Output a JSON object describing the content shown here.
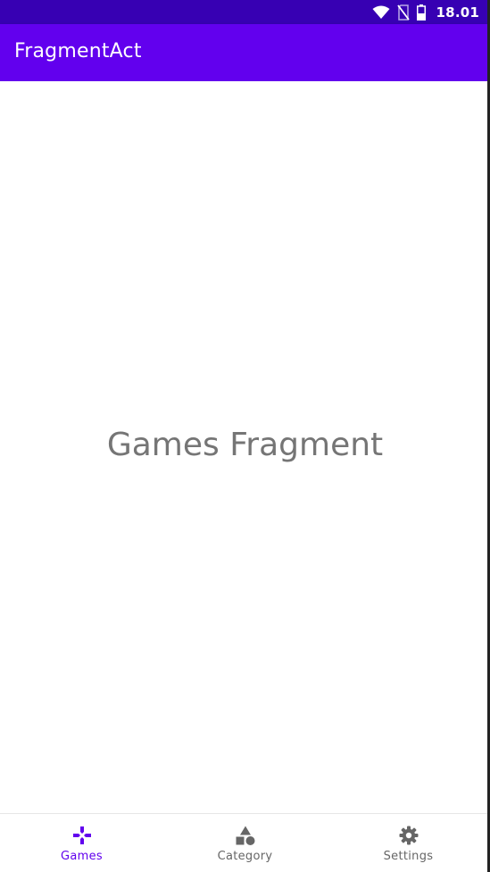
{
  "status_bar": {
    "time": "18.01",
    "icons": [
      "wifi-icon",
      "no-sim-icon",
      "battery-icon"
    ]
  },
  "app_bar": {
    "title": "FragmentAct"
  },
  "content": {
    "fragment_text": "Games Fragment"
  },
  "bottom_nav": {
    "items": [
      {
        "label": "Games",
        "icon": "gamepad-icon",
        "active": true
      },
      {
        "label": "Category",
        "icon": "category-icon",
        "active": false
      },
      {
        "label": "Settings",
        "icon": "gear-icon",
        "active": false
      }
    ]
  },
  "colors": {
    "primary": "#6200ee",
    "primary_dark": "#3700b3",
    "inactive": "#666666",
    "body_text": "#757575"
  }
}
